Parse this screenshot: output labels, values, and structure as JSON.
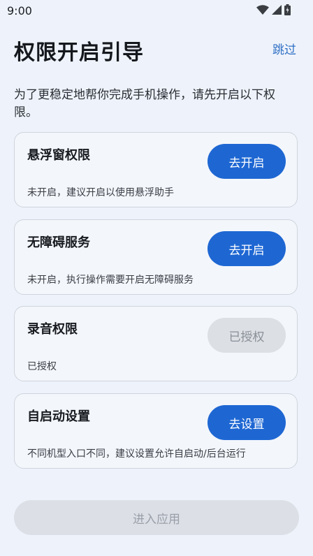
{
  "status_bar": {
    "time": "9:00",
    "icons": [
      "wifi-icon",
      "signal-icon",
      "battery-icon"
    ]
  },
  "header": {
    "title": "权限开启引导",
    "skip_label": "跳过"
  },
  "intro": "为了更稳定地帮你完成手机操作，请先开启以下权限。",
  "permissions": [
    {
      "title": "悬浮窗权限",
      "description": "未开启，建议开启以使用悬浮助手",
      "button_label": "去开启",
      "button_state": "enabled"
    },
    {
      "title": "无障碍服务",
      "description": "未开启，执行操作需要开启无障碍服务",
      "button_label": "去开启",
      "button_state": "enabled"
    },
    {
      "title": "录音权限",
      "description": "已授权",
      "button_label": "已授权",
      "button_state": "disabled"
    },
    {
      "title": "自启动设置",
      "description": "不同机型入口不同，建议设置允许自启动/后台运行",
      "button_label": "去设置",
      "button_state": "enabled"
    }
  ],
  "footer": {
    "enter_label": "进入应用",
    "enter_state": "disabled"
  },
  "colors": {
    "background": "#eef3fb",
    "primary": "#1e67d3",
    "link": "#2f6fc4",
    "disabled_bg": "#dcdfe4",
    "disabled_text": "#8a8f97"
  }
}
